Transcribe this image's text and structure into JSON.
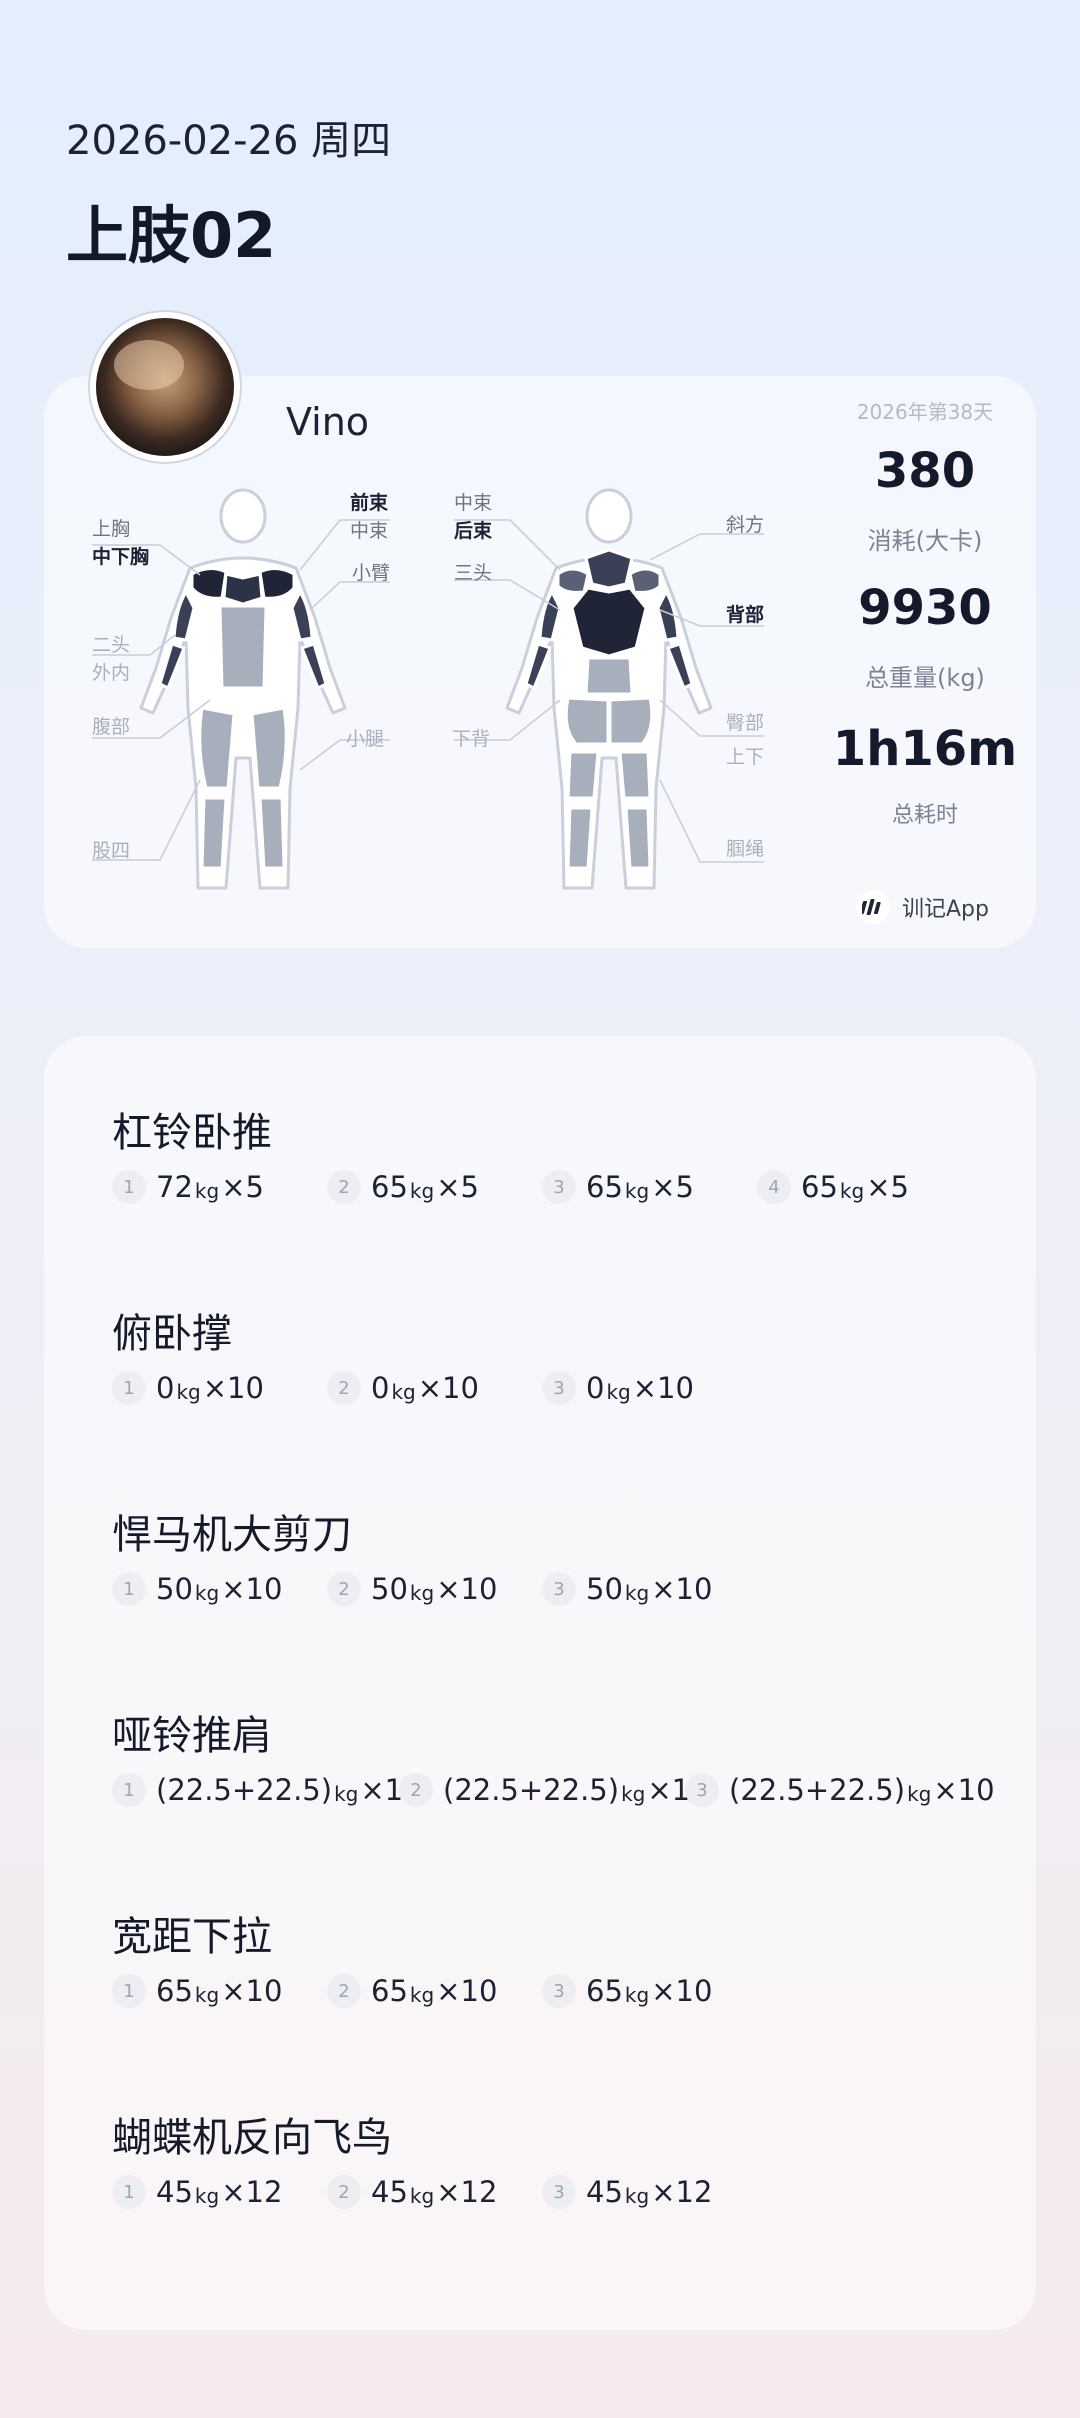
{
  "header": {
    "date": "2026-02-26 周四",
    "title": "上肢02"
  },
  "summary": {
    "username": "Vino",
    "day_count": "2026年第38天",
    "calories_value": "380",
    "calories_label": "消耗(大卡)",
    "weight_value": "9930",
    "weight_label": "总重量(kg)",
    "duration_value": "1h16m",
    "duration_label": "总耗时",
    "brand": "训记App",
    "front_labels": {
      "upper_chest": "上胸",
      "mid_lower_chest": "中下胸",
      "biceps": "二头",
      "forearm_inner": "外内",
      "abs": "腹部",
      "quads": "股四",
      "front_delt": "前束",
      "mid_delt": "中束",
      "triceps": "小臂",
      "calves": "小腿"
    },
    "back_labels": {
      "mid_delt": "中束",
      "rear_delt": "后束",
      "triceps": "三头",
      "lower_back": "下背",
      "traps": "斜方",
      "back": "背部",
      "glutes": "臀部",
      "up_down": "上下",
      "hamstrings": "腘绳"
    }
  },
  "workout": {
    "unit": "kg",
    "times": "×",
    "exercises": [
      {
        "name": "杠铃卧推",
        "sets": [
          {
            "n": "1",
            "w": "72",
            "r": "5"
          },
          {
            "n": "2",
            "w": "65",
            "r": "5"
          },
          {
            "n": "3",
            "w": "65",
            "r": "5"
          },
          {
            "n": "4",
            "w": "65",
            "r": "5"
          }
        ]
      },
      {
        "name": "俯卧撑",
        "sets": [
          {
            "n": "1",
            "w": "0",
            "r": "10"
          },
          {
            "n": "2",
            "w": "0",
            "r": "10"
          },
          {
            "n": "3",
            "w": "0",
            "r": "10"
          }
        ]
      },
      {
        "name": "悍马机大剪刀",
        "sets": [
          {
            "n": "1",
            "w": "50",
            "r": "10"
          },
          {
            "n": "2",
            "w": "50",
            "r": "10"
          },
          {
            "n": "3",
            "w": "50",
            "r": "10"
          }
        ]
      },
      {
        "name": "哑铃推肩",
        "sets": [
          {
            "n": "1",
            "w": "(22.5+22.5)",
            "r": "10"
          },
          {
            "n": "2",
            "w": "(22.5+22.5)",
            "r": "10"
          },
          {
            "n": "3",
            "w": "(22.5+22.5)",
            "r": "10"
          }
        ]
      },
      {
        "name": "宽距下拉",
        "sets": [
          {
            "n": "1",
            "w": "65",
            "r": "10"
          },
          {
            "n": "2",
            "w": "65",
            "r": "10"
          },
          {
            "n": "3",
            "w": "65",
            "r": "10"
          }
        ]
      },
      {
        "name": "蝴蝶机反向飞鸟",
        "sets": [
          {
            "n": "1",
            "w": "45",
            "r": "12"
          },
          {
            "n": "2",
            "w": "45",
            "r": "12"
          },
          {
            "n": "3",
            "w": "45",
            "r": "12"
          }
        ]
      }
    ]
  },
  "colors": {
    "worked_muscle": "#1f2436",
    "light_muscle": "#a7aebc",
    "body_outline": "#ffffff"
  }
}
